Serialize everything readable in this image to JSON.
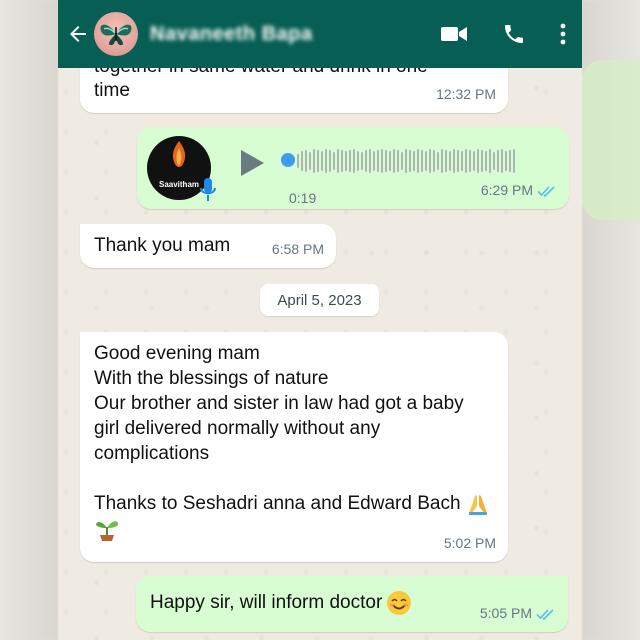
{
  "header": {
    "contact_name": "Navaneeth Bapa",
    "back_icon": "arrow-left-icon",
    "video_icon": "video-call-icon",
    "call_icon": "phone-icon",
    "menu_icon": "more-vert-icon",
    "bg_color": "#075e54"
  },
  "messages": [
    {
      "direction": "incoming",
      "cut_text": "together in same water and drink in one",
      "text": "time",
      "time": "12:32 PM"
    },
    {
      "direction": "outgoing",
      "type": "voice",
      "avatar_label": "Saavitham",
      "duration": "0:19",
      "time": "6:29 PM",
      "status": "read"
    },
    {
      "direction": "incoming",
      "text": "Thank you mam",
      "time": "6:58 PM"
    },
    {
      "direction": "incoming",
      "text": "Good evening mam\nWith the blessings of nature\nOur brother and sister in law had got a baby girl delivered normally without any complications\n\nThanks to Seshadri anna and Edward Bach",
      "emojis": [
        "folded-hands-icon",
        "seedling-icon"
      ],
      "time": "5:02 PM"
    },
    {
      "direction": "outgoing",
      "text": "Happy sir, will inform doctor",
      "emoji": "smiling-face-icon",
      "time": "5:05 PM",
      "status": "read"
    }
  ],
  "date_separator": "April 5, 2023",
  "colors": {
    "incoming_bubble": "#ffffff",
    "outgoing_bubble": "#d9fdd3",
    "read_ticks": "#53bdeb",
    "voice_progress": "#3d9df6"
  }
}
